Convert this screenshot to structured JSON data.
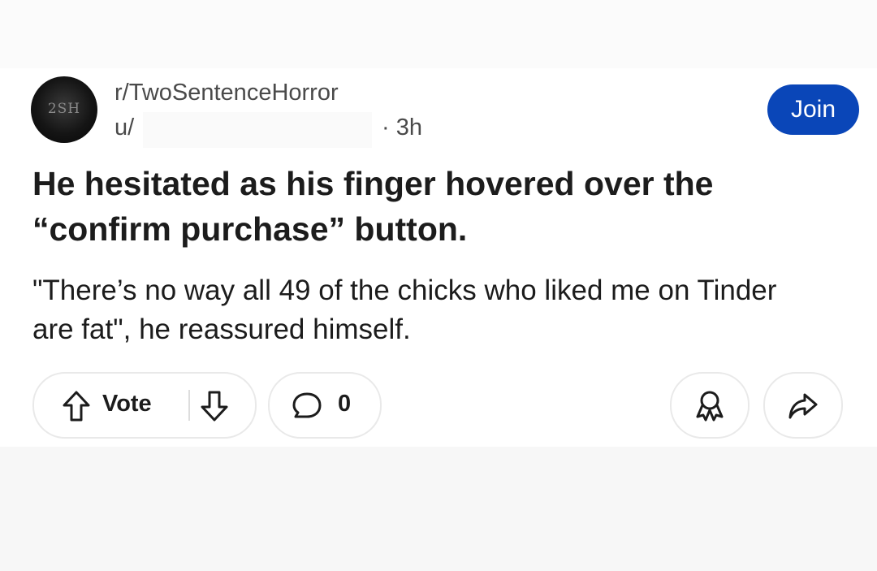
{
  "post": {
    "subreddit": "r/TwoSentenceHorror",
    "user_prefix": "u/",
    "time": "· 3h",
    "avatar_text": "2SH",
    "join_label": "Join",
    "title": "He hesitated as his finger hovered over the “confirm purchase” button.",
    "body": "\"There’s no way all 49 of the chicks who liked me on Tinder are fat\", he reassured himself."
  },
  "actions": {
    "vote_label": "Vote",
    "comment_count": "0"
  },
  "colors": {
    "join_button": "#0a46b8",
    "page_background": "#f6f6f6",
    "card_background": "#ffffff"
  },
  "icons": [
    "upvote-icon",
    "downvote-icon",
    "comment-icon",
    "award-icon",
    "share-icon"
  ]
}
